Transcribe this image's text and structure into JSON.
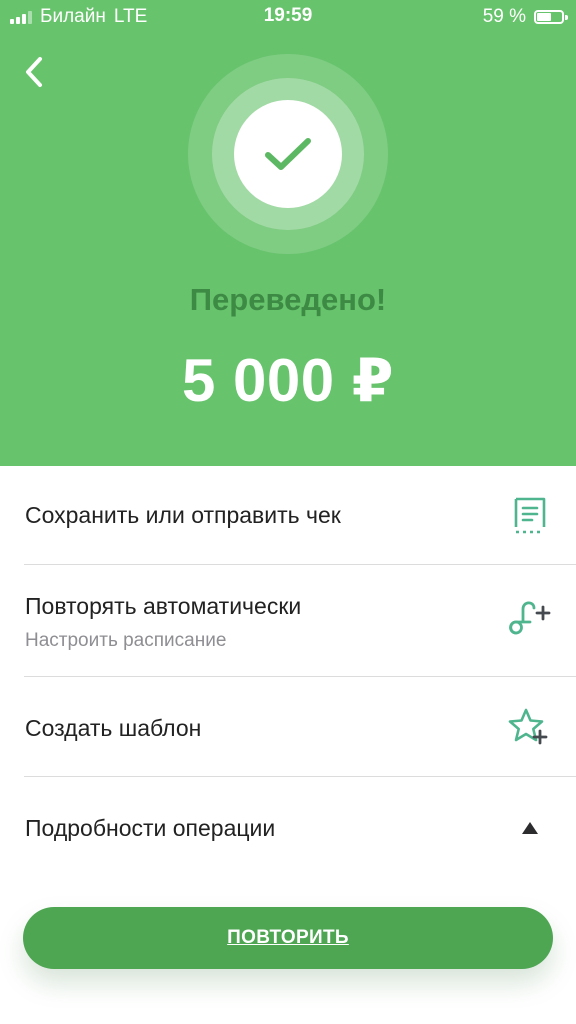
{
  "status_bar": {
    "carrier": "Билайн",
    "network": "LTE",
    "time": "19:59",
    "battery_percent": "59 %",
    "battery_level": 0.59,
    "signal_bars_filled": 3,
    "signal_bars_total": 4
  },
  "header": {
    "back_icon": "chevron-left-icon",
    "success_icon": "checkmark-icon",
    "status_title": "Переведено!",
    "amount": "5 000 ₽",
    "background_color": "#67c36c",
    "title_color": "#3d8a44"
  },
  "actions": [
    {
      "title": "Сохранить или отправить чек",
      "subtitle": "",
      "icon": "receipt-icon"
    },
    {
      "title": "Повторять автоматически",
      "subtitle": "Настроить расписание",
      "icon": "autopay-add-icon"
    },
    {
      "title": "Создать шаблон",
      "subtitle": "",
      "icon": "star-add-icon"
    },
    {
      "title": "Подробности операции",
      "subtitle": "",
      "icon": "triangle-up-icon"
    }
  ],
  "repeat_button": {
    "label": "ПОВТОРИТЬ",
    "color": "#4ea653"
  }
}
